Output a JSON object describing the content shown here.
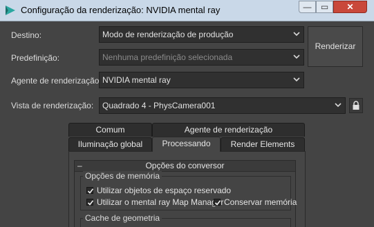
{
  "window": {
    "title": "Configuração da renderização: NVIDIA mental ray",
    "buttons": {
      "minimize": "—",
      "maximize": "▭",
      "close": "✕"
    }
  },
  "form": {
    "destino": {
      "label": "Destino:",
      "value": "Modo de renderização de produção"
    },
    "predefinicao": {
      "label": "Predefinição:",
      "value": "Nenhuma predefinição selecionada"
    },
    "agente": {
      "label": "Agente de renderização:",
      "value": "NVIDIA mental ray"
    },
    "vista": {
      "label": "Vista de renderização:",
      "value": "Quadrado 4 - PhysCamera001"
    },
    "render_button": "Renderizar"
  },
  "tabs": {
    "row1": [
      "Comum",
      "Agente de renderização"
    ],
    "row2": [
      "Iluminação global",
      "Processando",
      "Render Elements"
    ],
    "active": "Processando"
  },
  "rollout": {
    "toggle": "–",
    "title": "Opções do conversor",
    "memory_group": {
      "label": "Opções de memória",
      "opt1": {
        "label": "Utilizar objetos de espaço reservado",
        "checked": true
      },
      "opt2": {
        "label": "Utilizar o mental ray Map Manager",
        "checked": true
      },
      "opt3": {
        "label": "Conservar memória",
        "checked": true
      }
    },
    "geometry_group": {
      "label": "Cache de geometria"
    }
  },
  "colors": {
    "background": "#444444",
    "field": "#303030",
    "titlebar": "#c9d8e8",
    "close": "#c9483a"
  }
}
